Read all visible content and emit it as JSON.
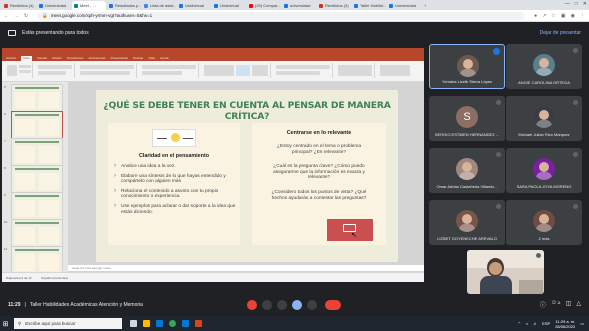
{
  "browser": {
    "tabs": [
      {
        "label": "Recibidos (4)",
        "color": "#d93025"
      },
      {
        "label": "Universidad",
        "color": "#1a73e8"
      },
      {
        "label": "Meet - ...",
        "color": "#00897b",
        "active": true
      },
      {
        "label": "Resultados p...",
        "color": "#1a73e8"
      },
      {
        "label": "Lista de asist...",
        "color": "#4285f4"
      },
      {
        "label": "Unidvirtual",
        "color": "#1a73e8"
      },
      {
        "label": "Unidvirtual",
        "color": "#1a73e8"
      },
      {
        "label": "(29) Compar...",
        "color": "#ff0000"
      },
      {
        "label": "universidad",
        "color": "#1a73e8"
      },
      {
        "label": "Recibidos (4)",
        "color": "#d93025"
      },
      {
        "label": "Taller Habilid...",
        "color": "#1a73e8"
      },
      {
        "label": "Universidad",
        "color": "#1a73e8"
      }
    ],
    "url": "meet.google.com/xph-yrmm-vgt?authuser=0&hs=1"
  },
  "meet": {
    "presenting_label": "Estás presentando para todos",
    "stop_presenting": "Dejar de presentar",
    "meeting_time": "11:29",
    "meeting_title": "Taller Habilidades Académicas Atención y Memoria",
    "participant_count": "11"
  },
  "powerpoint": {
    "menu": [
      "Archivo",
      "Inicio",
      "Insertar",
      "Diseño",
      "Transiciones",
      "Animaciones",
      "Presentación",
      "Revisar",
      "Vista",
      "Ayuda"
    ],
    "notes_placeholder": "Haga clic para agregar notas",
    "status_left": "Diapositiva 6 de 12",
    "status_lang": "Español (Colombia)",
    "thumb_numbers": [
      "5",
      "6",
      "7",
      "8",
      "9",
      "10",
      "11"
    ]
  },
  "slide": {
    "title": "¿QUÉ SE DEBE TENER EN CUENTA AL PENSAR DE MANERA CRÍTICA?",
    "left_heading": "Claridad en el pensamiento",
    "left_bullets": [
      "Analice una idea a la vez.",
      "Elabore una síntesis de lo que hayas entendido y compártelo con alguien más",
      "Relaciona el contenido a asunto con tu propio conocimiento o experiencia.",
      "Use ejemplos para aclarar o dar soporte a la idea que estás diciendo."
    ],
    "right_heading": "Centrarse en lo relevante",
    "right_paragraphs": [
      "¿Estoy centrado en el tema o problema principal? ¿Es relevante?",
      "¿Cuál es la pregunta clave? ¿Cómo puedo asegurarme que la información es exacta y relevante?",
      "¿Considero todos los puntos de vista? ¿Qué hechos ayudarán a contestar las preguntas?"
    ]
  },
  "participants": [
    {
      "name": "Yomaira Lizeth Sierra López",
      "speaking": true,
      "avatar_color": "#6d5a4f"
    },
    {
      "name": "ANGIE CAROLINA ORTEGA",
      "avatar_color": "#5b7d8c"
    },
    {
      "name": "SERGIO ESTIBEN HERNANDEZ ...",
      "avatar_letter": "S",
      "avatar_color": "#8d6e63"
    },
    {
      "name": "Michael Julian Rico Marquez",
      "avatar_color": "#3b3b46"
    },
    {
      "name": "Omar Adrian Castañeda Villamiz...",
      "avatar_color": "#a1887f"
    },
    {
      "name": "SARA PAOLA JOYA MORENO",
      "avatar_color": "#7b1fa2"
    },
    {
      "name": "LIZBET GOYENECHE AREVALO",
      "avatar_color": "#795548"
    },
    {
      "name": "2 más",
      "avatar_color": "#6d4c41"
    }
  ],
  "taskbar": {
    "search_placeholder": "Escribe aquí para buscar",
    "time": "11:29 a. m.",
    "date": "28/06/2022",
    "lang": "ESP"
  }
}
